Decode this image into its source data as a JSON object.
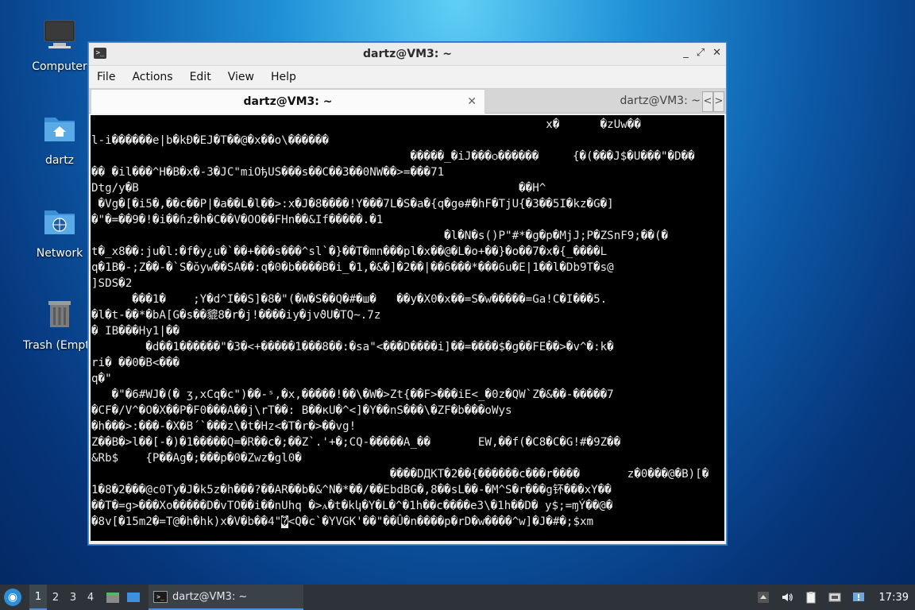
{
  "desktop": {
    "icons": [
      {
        "label": "Computer"
      },
      {
        "label": "dartz"
      },
      {
        "label": "Network"
      },
      {
        "label": "Trash (Empty)"
      }
    ]
  },
  "window": {
    "title": "dartz@VM3: ~",
    "controls": {
      "minimize": "_",
      "maximize": "⤢",
      "close": "✕"
    },
    "menu": [
      "File",
      "Actions",
      "Edit",
      "View",
      "Help"
    ],
    "tabs": [
      {
        "label": "dartz@VM3: ~",
        "close": "✕",
        "active": true
      },
      {
        "label": "dartz@VM3: ~",
        "active": false
      }
    ],
    "tab_nav": {
      "left": "<",
      "right": ">"
    }
  },
  "terminal": {
    "lines": [
      "                                                                   x�      �zUw��",
      "l-i������e|b�kĐ�EJ�T��@�x��o\\������",
      "                                               �����_�iJ���ѻ������     {�(���J$�U���\"�D��",
      "�� �il���^H�B�x�-3�JC\"miOђUS���s��C��3��0NW��>=���71",
      "Dtg/y�B                                                        ��H^",
      " �Vg�[�i5�,��c��P|�a��L�l��>:x�J�8����!Y���7L�S�a�{q�gѳ#�hF�TjU{�3��5I�kz�G�]",
      "�\"�=��9�!�i��ɦz�h�C��V�OO��FHn��&If�����.�1",
      "                                                    �l�N�s()P\"#*�g�p�MjJ;P�ZSnF9;��(�",
      "t�_x8��:ju�l:�f�y¿u�`��+���s���^sl`�}��T�mn���pl�x��@�L�o+��}�o��7�x�{_����L",
      "q�1B�-;Z��-�`S�ŏyw��SA��:q�0�b����B�i_�1,�&�]�2��|��6���*���6u�E|1��l�Db9T�s@",
      "]SDS�2",
      "      ���1�    ;Y�d^I��S]�8�\"(�W�S��Q�#�ш�   ��y�X0�x��=S�w�����=Ga!C�I���5.",
      "�l�t-��*�bA[G�s��貔8�r�j!����iy�jvϑU�TQ~.7z",
      "� IB���Hy1|��",
      "        �d��1������\"�3�<+�����1���8��:�sa\"<���D����i]��=����$�g��FE��>�v^�:k�",
      "ri� ��0�B<���",
      "q�\"",
      "   �\"�6#WJ�(� ӡ,xCq�c\")��-ˢ,�x,�����!��\\�W�>Zt{��F>���iE<_�0z�QW`Z�&��-�����7",
      "�CF�/V^�O�X��P�F0���A��j\\rT��: B��кU�^<]�Y��nS���\\�ZF�b���oWys",
      "�h���>:���-�X�B´`���z\\�t�Hz<�T�r�>��vg!",
      "Z��B�>l��[-�)�1�����Q=�R��c�;��Z`.'+�;CQ-�����A_��       EW,��f(�C8�C�G!#�9Z��",
      "&Rb$    {P��Ag�;���p�0�Zwz�gl0�",
      "                                            ����DДKT�2��{������c���r����       z�0���@�B)[�",
      "1�8�2���@c0Ty�J�k5z�h���?��AR��b�&^N�*��/��EbdBG�,8��sL��-�M^S�r���g钚���xY��",
      "��T�=g>���Xo�����D�vTO��i��nUhq �>ꭺ�t�kկ�Y�L�^�1h��c����e3\\�1h��D� y$;=ɱÝ��@�",
      "�8v[�15m2�=T@�h�hk)x�V�b��4\"",
      "                              <Q�c`�YVGK'��\"��Û�n����p�rD�w����^w]�J�#�;$xm"
    ],
    "cursor_line_prefix": "�8v[�15m2�=T@�h�hk)x�V�b��4\"",
    "cursor_char": "�",
    "cursor_line_suffix": "<Q�c`�YVGK'��\"��Û�n����p�rD�w����^w]�J�#�;$xm"
  },
  "taskbar": {
    "workspaces": [
      "1",
      "2",
      "3",
      "4"
    ],
    "active_workspace": "1",
    "task_label": "dartz@VM3: ~",
    "clock": "17:39"
  },
  "colors": {
    "accent": "#4a90d9",
    "taskbar": "#2d3338",
    "terminal_bg": "#000000"
  }
}
